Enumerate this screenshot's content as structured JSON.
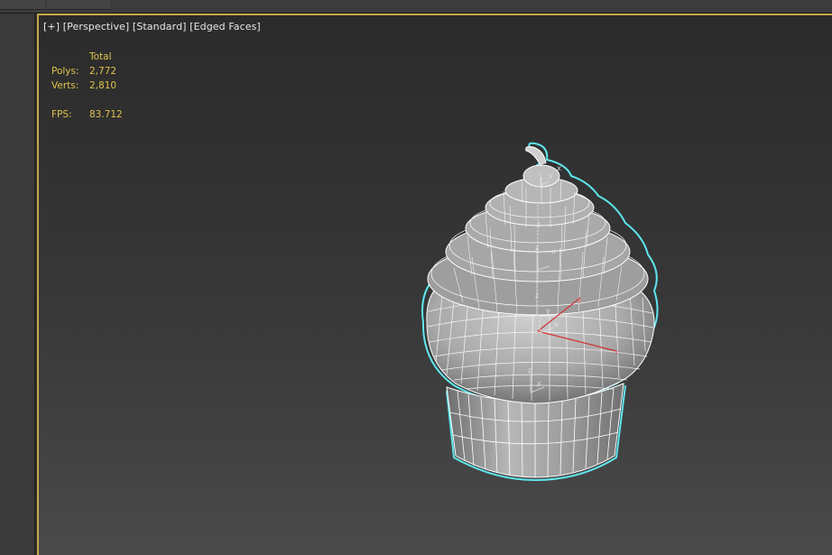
{
  "viewport": {
    "label_parts": [
      "[+]",
      "[Perspective]",
      "[Standard]",
      "[Edged Faces]"
    ]
  },
  "stats": {
    "header": "Total",
    "polys_label": "Polys:",
    "polys_value": "2,772",
    "verts_label": "Verts:",
    "verts_value": "2,810",
    "fps_label": "FPS:",
    "fps_value": "83.712"
  },
  "gizmo_axes": {
    "x": "x",
    "y": "y",
    "z": "z"
  },
  "colors": {
    "frame_accent": "#caa94a",
    "stats_text": "#e0c24a",
    "selection_outline": "#5fe6ee",
    "axis_red": "#d03030",
    "mesh_wire": "#ffffff"
  }
}
